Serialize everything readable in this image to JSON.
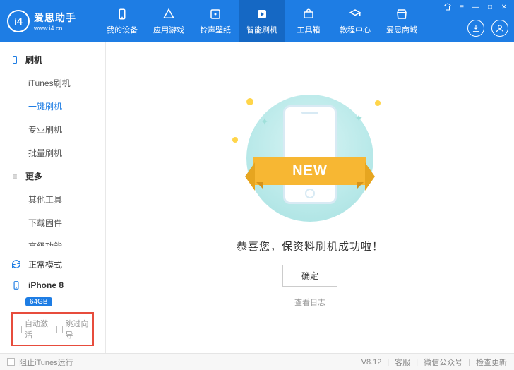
{
  "brand": {
    "logo_glyph": "i4",
    "title": "爱思助手",
    "subtitle": "www.i4.cn"
  },
  "nav": [
    {
      "label": "我的设备",
      "icon": "device"
    },
    {
      "label": "应用游戏",
      "icon": "apps"
    },
    {
      "label": "铃声壁纸",
      "icon": "ringtone"
    },
    {
      "label": "智能刷机",
      "icon": "flash",
      "active": true
    },
    {
      "label": "工具箱",
      "icon": "toolbox"
    },
    {
      "label": "教程中心",
      "icon": "tutorial"
    },
    {
      "label": "爱思商城",
      "icon": "store"
    }
  ],
  "sidebar": {
    "sections": [
      {
        "title": "刷机",
        "type": "flash",
        "items": [
          {
            "label": "iTunes刷机"
          },
          {
            "label": "一键刷机",
            "active": true
          },
          {
            "label": "专业刷机"
          },
          {
            "label": "批量刷机"
          }
        ]
      },
      {
        "title": "更多",
        "type": "more",
        "items": [
          {
            "label": "其他工具"
          },
          {
            "label": "下载固件"
          },
          {
            "label": "高级功能"
          }
        ]
      }
    ],
    "mode": {
      "label": "正常模式"
    },
    "device": {
      "name": "iPhone 8",
      "capacity": "64GB"
    },
    "options": {
      "auto_activate": "自动激活",
      "skip_wizard": "跳过向导"
    }
  },
  "main": {
    "ribbon_text": "NEW",
    "success_text": "恭喜您，保资料刷机成功啦！",
    "confirm_label": "确定",
    "view_log": "查看日志"
  },
  "footer": {
    "block_itunes": "阻止iTunes运行",
    "version": "V8.12",
    "links": [
      "客服",
      "微信公众号",
      "检查更新"
    ]
  }
}
